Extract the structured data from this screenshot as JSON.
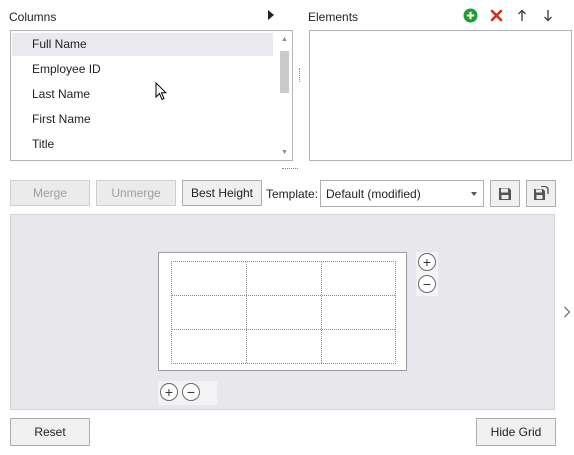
{
  "columns_panel": {
    "title": "Columns",
    "items": [
      "Full Name",
      "Employee ID",
      "Last Name",
      "First Name",
      "Title"
    ],
    "selected_index": 0
  },
  "elements_panel": {
    "title": "Elements",
    "icons": [
      "add-icon",
      "delete-icon",
      "move-up-icon",
      "move-down-icon"
    ],
    "colors": {
      "add": "#1f9d2f",
      "delete": "#d32a1f"
    }
  },
  "toolbar": {
    "merge_label": "Merge",
    "unmerge_label": "Unmerge",
    "best_height_label": "Best Height",
    "template_label": "Template:",
    "template_value": "Default (modified)"
  },
  "footer": {
    "reset_label": "Reset",
    "hide_grid_label": "Hide Grid"
  },
  "grid_controls": {
    "plus": "+",
    "minus": "−"
  }
}
